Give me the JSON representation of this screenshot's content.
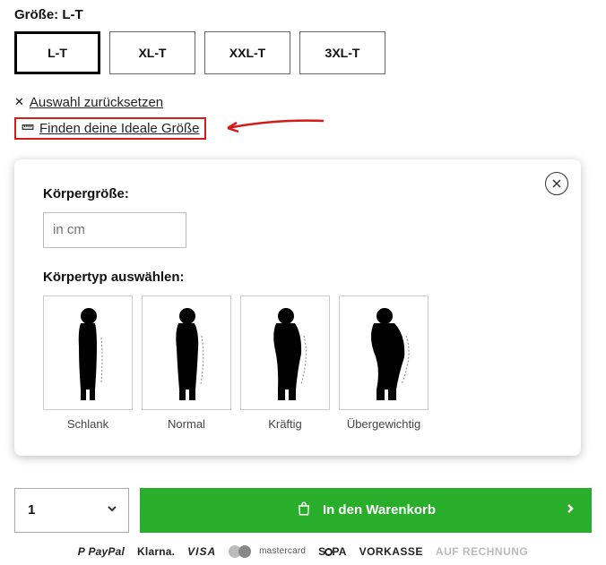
{
  "size": {
    "label_prefix": "Größe:",
    "selected": "L-T",
    "options": [
      "L-T",
      "XL-T",
      "XXL-T",
      "3XL-T"
    ]
  },
  "reset_label": "Auswahl zurücksetzen",
  "find_label": "Finden deine Ideale Größe",
  "modal": {
    "height_label": "Körpergröße:",
    "height_placeholder": "in cm",
    "bodytype_label": "Körpertyp auswählen:",
    "types": [
      "Schlank",
      "Normal",
      "Kräftig",
      "Übergewichtig"
    ]
  },
  "qty_value": "1",
  "cart_label": "In den Warenkorb",
  "payments": {
    "paypal": "PayPal",
    "klarna": "Klarna.",
    "visa": "VISA",
    "mastercard": "mastercard",
    "sepa_s": "S",
    "sepa_pa": "PA",
    "vorkasse": "VORKASSE",
    "rechnung": "AUF RECHNUNG"
  }
}
